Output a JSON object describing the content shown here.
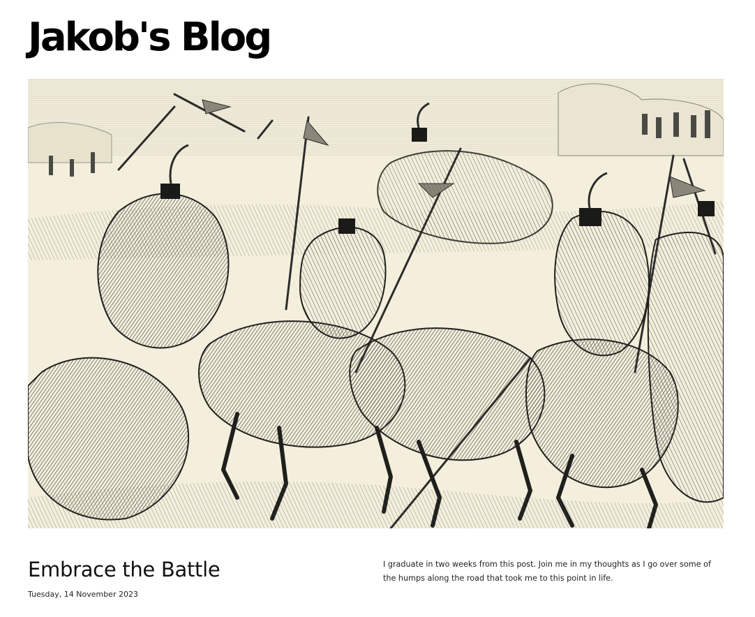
{
  "site": {
    "title": "Jakob's Blog"
  },
  "hero_image": {
    "icon": "engraving-illustration-icon",
    "palette": {
      "paper": "#f3efdc",
      "ink": "#2b2b2b",
      "mid": "#6d6d66",
      "light": "#b9b6a6"
    }
  },
  "post": {
    "title": "Embrace the Battle",
    "date": "Tuesday, 14 November 2023",
    "excerpt": "I graduate in two weeks from this post. Join me in my thoughts as I go over some of the humps along the road that took me to this point in life."
  }
}
